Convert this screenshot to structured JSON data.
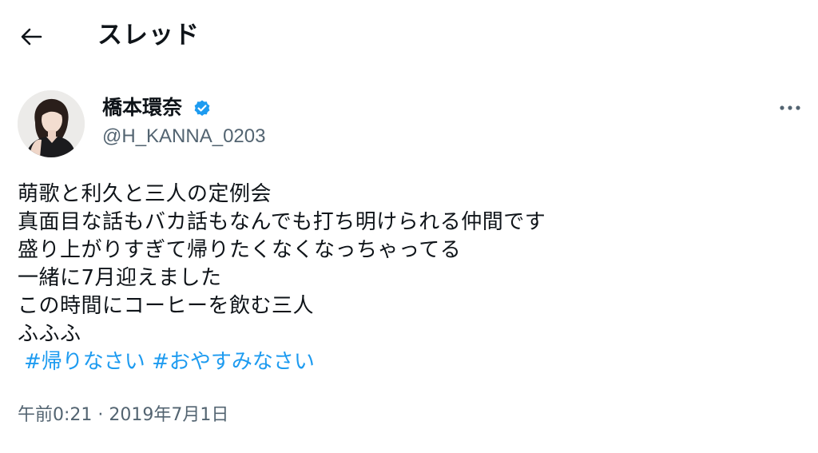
{
  "header": {
    "title": "スレッド",
    "back_icon": "arrow-left-icon"
  },
  "author": {
    "display_name": "橋本環奈",
    "handle": "@H_KANNA_0203",
    "verified": true,
    "verified_color": "#1d9bf0"
  },
  "tweet": {
    "lines": [
      "萌歌と利久と三人の定例会",
      "真面目な話もバカ話もなんでも打ち明けられる仲間です",
      "盛り上がりすぎて帰りたくなくなっちゃってる",
      "一緒に7月迎えました",
      "この時間にコーヒーを飲む三人",
      "ふふふ"
    ],
    "hashtags": [
      "#帰りなさい",
      "#おやすみなさい"
    ],
    "hashtag_color": "#1d9bf0",
    "timestamp": "午前0:21 · 2019年7月1日"
  }
}
